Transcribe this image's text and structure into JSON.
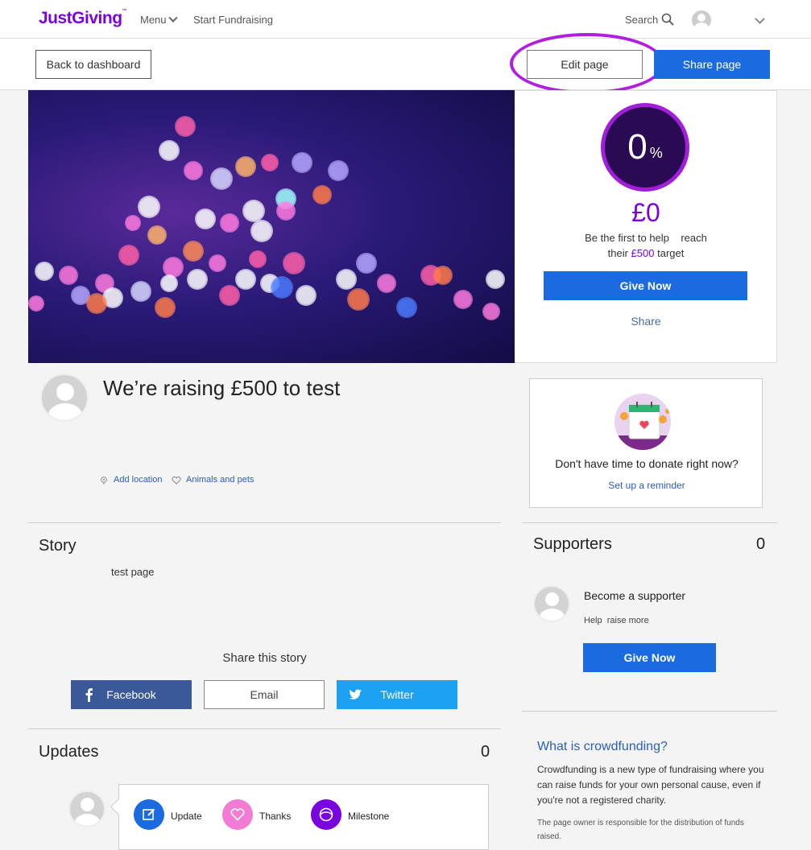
{
  "nav": {
    "logo": "JustGiving",
    "menu": "Menu",
    "start": "Start Fundraising",
    "search": "Search"
  },
  "actions": {
    "back": "Back to dashboard",
    "edit": "Edit page",
    "share": "Share page"
  },
  "progress": {
    "percent": "0",
    "percent_sign": "%",
    "amount": "£0",
    "line1": "Be the first to help    reach",
    "line2_pre": "their ",
    "target": "£500",
    "line2_post": " target",
    "give": "Give Now",
    "share": "Share",
    "fraction": 0
  },
  "page": {
    "title": "We’re raising £500 to test",
    "location": "Add location",
    "category": "Animals and pets"
  },
  "reminder": {
    "text": "Don't have time to donate right now?",
    "link": "Set up a reminder"
  },
  "story": {
    "heading": "Story",
    "text": "test page",
    "share_heading": "Share this story",
    "facebook": "Facebook",
    "email": "Email",
    "twitter": "Twitter"
  },
  "supporters": {
    "heading": "Supporters",
    "count": "0",
    "become": "Become a supporter",
    "help": "Help  raise more",
    "give": "Give Now"
  },
  "crowdfunding": {
    "title": "What is crowdfunding?",
    "body": "Crowdfunding is a new type of fundraising where you can raise funds for your own personal cause, even if you're not a registered charity.",
    "note": "The page owner is responsible for the distribution of funds raised."
  },
  "updates": {
    "heading": "Updates",
    "count": "0",
    "update": "Update",
    "thanks": "Thanks",
    "milestone": "Milestone"
  },
  "colors": {
    "brand_purple": "#7a04dd",
    "primary_blue": "#1a6ae0",
    "highlight_ring": "#b21ee0"
  }
}
